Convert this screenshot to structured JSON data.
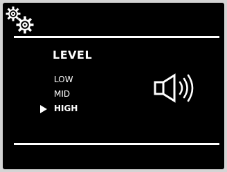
{
  "menu": {
    "title": "LEVEL",
    "options": [
      {
        "label": "LOW"
      },
      {
        "label": "MID"
      },
      {
        "label": "HIGH"
      }
    ],
    "selected": "HIGH"
  },
  "icons": {
    "settings": "gears-icon",
    "volume": "speaker-volume-icon",
    "pointer": "triangle-pointer-icon"
  },
  "colors": {
    "background": "#000000",
    "foreground": "#ffffff"
  }
}
